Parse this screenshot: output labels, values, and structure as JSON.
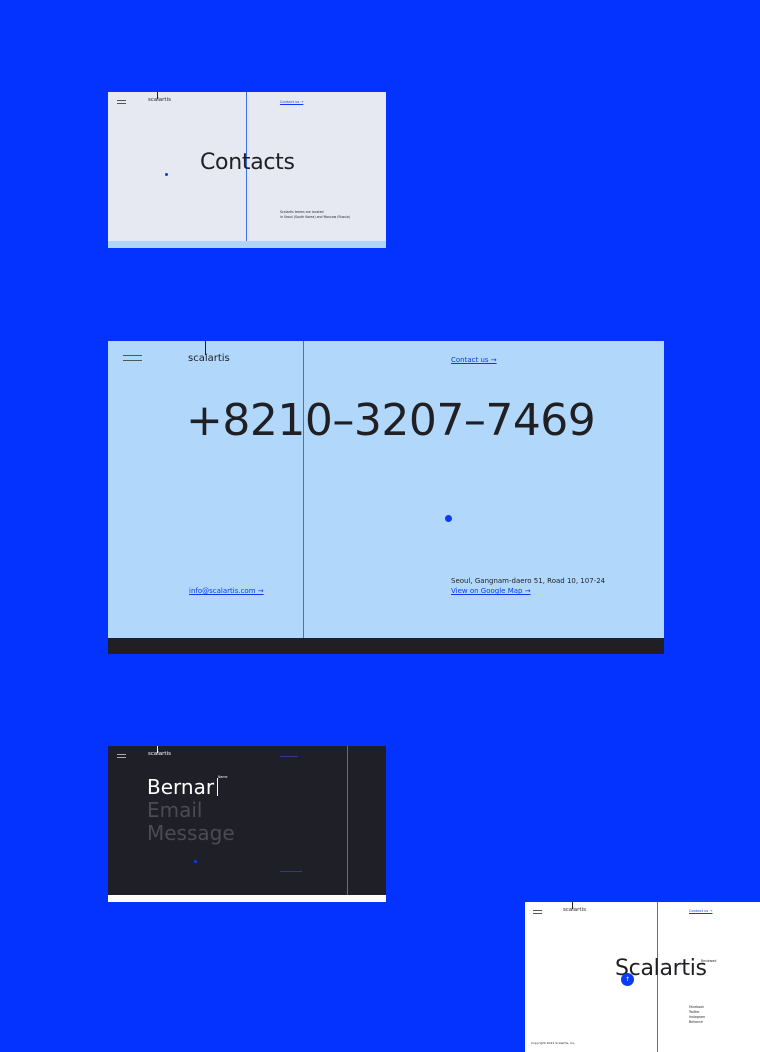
{
  "frames": {
    "contacts": {
      "logo": "scalartis",
      "contact_link": "Contact us →",
      "title": "Contacts",
      "note_lines": [
        "Scalartis teams are located",
        "in Seoul (South Korea) and Moscow (Russia)"
      ]
    },
    "phone": {
      "logo": "scalartis",
      "contact_link": "Contact us →",
      "phone_number": "+8210–3207–7469",
      "email_link": "info@scalartis.com →",
      "address": "Seoul, Gangnam-daero 51, Road 10, 107-24",
      "map_link": "View on Google Map →"
    },
    "form": {
      "logo": "scalartis",
      "name_value": "Bernar",
      "name_tag": "Name",
      "email_placeholder": "Email",
      "message_placeholder": "Message"
    },
    "about": {
      "logo": "scalartis",
      "contact_link": "Contact us →",
      "brand": "Scalartis",
      "brand_tag": "Reviewed",
      "fab_icon": "↑",
      "social_links": [
        "Facebook",
        "Twitter",
        "Instagram",
        "Behance"
      ],
      "copyright": "Copyright 2024 Scalartis, Inc."
    }
  },
  "colors": {
    "background": "#0433ff",
    "accent": "#0a3cf4",
    "light_blue": "#b1d7fb",
    "dark": "#1f1f27"
  }
}
